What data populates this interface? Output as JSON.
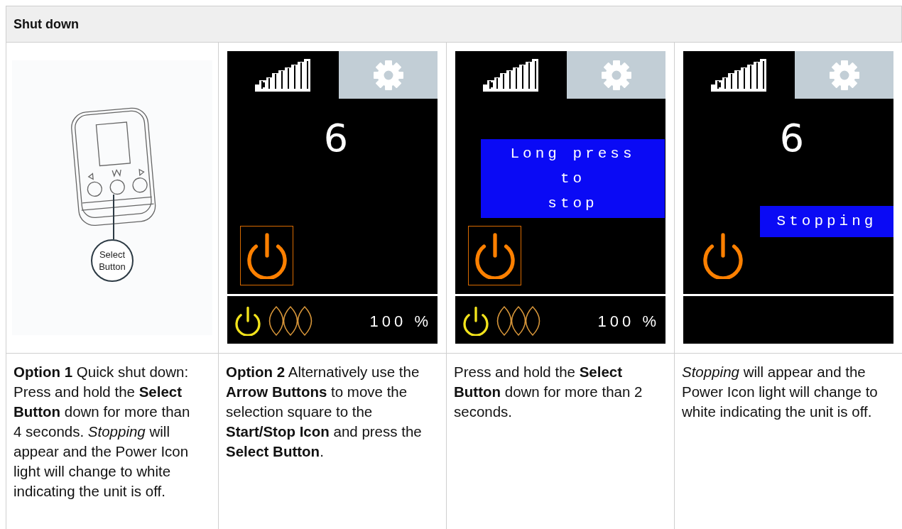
{
  "section": {
    "title": "Shut down"
  },
  "illustration": {
    "callout": "Select Button"
  },
  "screens": [
    {
      "number": "6",
      "power_selected": true,
      "status_reading": "100 %"
    },
    {
      "power_selected": true,
      "message": {
        "kind": "dialog",
        "lines": [
          "Long press",
          "to",
          "stop"
        ]
      },
      "status_reading": "100 %"
    },
    {
      "number": "6",
      "power_selected": false,
      "message": {
        "kind": "banner",
        "lines": [
          "Stopping"
        ]
      }
    }
  ],
  "captions": [
    "**Option 1** Quick shut down: Press and hold the **Select Button** down for more than 4 seconds. *Stopping* will appear and the Power Icon light will change to white indicating the unit is off.",
    "**Option 2** Alternatively use the **Arrow Buttons** to move the selection square to the **Start/Stop Icon** and press the **Select Button**.",
    "Press and hold the **Select Button** down for more than 2 seconds.",
    "*Stopping* will appear and the Power Icon light will change to white indicating the unit is off."
  ]
}
